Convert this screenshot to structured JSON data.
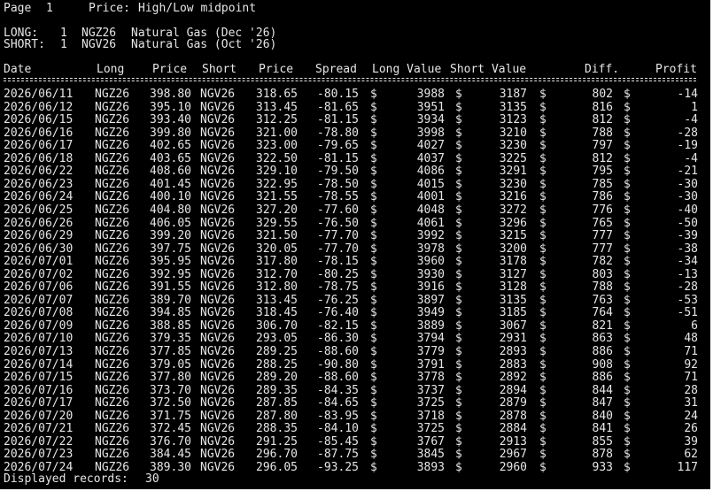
{
  "header": {
    "page_label": "Page",
    "page_number": "1",
    "price_label": "Price:",
    "price_mode": "High/Low midpoint"
  },
  "positions": {
    "long": {
      "label": "LONG:",
      "qty": "1",
      "symbol": "NGZ26",
      "description": "Natural Gas (Dec '26)"
    },
    "short": {
      "label": "SHORT:",
      "qty": "1",
      "symbol": "NGV26",
      "description": "Natural Gas (Oct '26)"
    }
  },
  "table": {
    "columns": [
      "Date",
      "Long",
      "Price",
      "Short",
      "Price",
      "Spread",
      "Long Value",
      "Short Value",
      "Diff.",
      "Profit"
    ],
    "currency_symbol": "$",
    "rows": [
      {
        "date": "2026/06/11",
        "long": "NGZ26",
        "long_price": "398.80",
        "short": "NGV26",
        "short_price": "318.65",
        "spread": "-80.15",
        "long_value": "3988",
        "short_value": "3187",
        "diff": "802",
        "profit": "-14"
      },
      {
        "date": "2026/06/12",
        "long": "NGZ26",
        "long_price": "395.10",
        "short": "NGV26",
        "short_price": "313.45",
        "spread": "-81.65",
        "long_value": "3951",
        "short_value": "3135",
        "diff": "816",
        "profit": "1"
      },
      {
        "date": "2026/06/15",
        "long": "NGZ26",
        "long_price": "393.40",
        "short": "NGV26",
        "short_price": "312.25",
        "spread": "-81.15",
        "long_value": "3934",
        "short_value": "3123",
        "diff": "812",
        "profit": "-4"
      },
      {
        "date": "2026/06/16",
        "long": "NGZ26",
        "long_price": "399.80",
        "short": "NGV26",
        "short_price": "321.00",
        "spread": "-78.80",
        "long_value": "3998",
        "short_value": "3210",
        "diff": "788",
        "profit": "-28"
      },
      {
        "date": "2026/06/17",
        "long": "NGZ26",
        "long_price": "402.65",
        "short": "NGV26",
        "short_price": "323.00",
        "spread": "-79.65",
        "long_value": "4027",
        "short_value": "3230",
        "diff": "797",
        "profit": "-19"
      },
      {
        "date": "2026/06/18",
        "long": "NGZ26",
        "long_price": "403.65",
        "short": "NGV26",
        "short_price": "322.50",
        "spread": "-81.15",
        "long_value": "4037",
        "short_value": "3225",
        "diff": "812",
        "profit": "-4"
      },
      {
        "date": "2026/06/22",
        "long": "NGZ26",
        "long_price": "408.60",
        "short": "NGV26",
        "short_price": "329.10",
        "spread": "-79.50",
        "long_value": "4086",
        "short_value": "3291",
        "diff": "795",
        "profit": "-21"
      },
      {
        "date": "2026/06/23",
        "long": "NGZ26",
        "long_price": "401.45",
        "short": "NGV26",
        "short_price": "322.95",
        "spread": "-78.50",
        "long_value": "4015",
        "short_value": "3230",
        "diff": "785",
        "profit": "-30"
      },
      {
        "date": "2026/06/24",
        "long": "NGZ26",
        "long_price": "400.10",
        "short": "NGV26",
        "short_price": "321.55",
        "spread": "-78.55",
        "long_value": "4001",
        "short_value": "3216",
        "diff": "786",
        "profit": "-30"
      },
      {
        "date": "2026/06/25",
        "long": "NGZ26",
        "long_price": "404.80",
        "short": "NGV26",
        "short_price": "327.20",
        "spread": "-77.60",
        "long_value": "4048",
        "short_value": "3272",
        "diff": "776",
        "profit": "-40"
      },
      {
        "date": "2026/06/26",
        "long": "NGZ26",
        "long_price": "406.05",
        "short": "NGV26",
        "short_price": "329.55",
        "spread": "-76.50",
        "long_value": "4061",
        "short_value": "3296",
        "diff": "765",
        "profit": "-50"
      },
      {
        "date": "2026/06/29",
        "long": "NGZ26",
        "long_price": "399.20",
        "short": "NGV26",
        "short_price": "321.50",
        "spread": "-77.70",
        "long_value": "3992",
        "short_value": "3215",
        "diff": "777",
        "profit": "-39"
      },
      {
        "date": "2026/06/30",
        "long": "NGZ26",
        "long_price": "397.75",
        "short": "NGV26",
        "short_price": "320.05",
        "spread": "-77.70",
        "long_value": "3978",
        "short_value": "3200",
        "diff": "777",
        "profit": "-38"
      },
      {
        "date": "2026/07/01",
        "long": "NGZ26",
        "long_price": "395.95",
        "short": "NGV26",
        "short_price": "317.80",
        "spread": "-78.15",
        "long_value": "3960",
        "short_value": "3178",
        "diff": "782",
        "profit": "-34"
      },
      {
        "date": "2026/07/02",
        "long": "NGZ26",
        "long_price": "392.95",
        "short": "NGV26",
        "short_price": "312.70",
        "spread": "-80.25",
        "long_value": "3930",
        "short_value": "3127",
        "diff": "803",
        "profit": "-13"
      },
      {
        "date": "2026/07/06",
        "long": "NGZ26",
        "long_price": "391.55",
        "short": "NGV26",
        "short_price": "312.80",
        "spread": "-78.75",
        "long_value": "3916",
        "short_value": "3128",
        "diff": "788",
        "profit": "-28"
      },
      {
        "date": "2026/07/07",
        "long": "NGZ26",
        "long_price": "389.70",
        "short": "NGV26",
        "short_price": "313.45",
        "spread": "-76.25",
        "long_value": "3897",
        "short_value": "3135",
        "diff": "763",
        "profit": "-53"
      },
      {
        "date": "2026/07/08",
        "long": "NGZ26",
        "long_price": "394.85",
        "short": "NGV26",
        "short_price": "318.45",
        "spread": "-76.40",
        "long_value": "3949",
        "short_value": "3185",
        "diff": "764",
        "profit": "-51"
      },
      {
        "date": "2026/07/09",
        "long": "NGZ26",
        "long_price": "388.85",
        "short": "NGV26",
        "short_price": "306.70",
        "spread": "-82.15",
        "long_value": "3889",
        "short_value": "3067",
        "diff": "821",
        "profit": "6"
      },
      {
        "date": "2026/07/10",
        "long": "NGZ26",
        "long_price": "379.35",
        "short": "NGV26",
        "short_price": "293.05",
        "spread": "-86.30",
        "long_value": "3794",
        "short_value": "2931",
        "diff": "863",
        "profit": "48"
      },
      {
        "date": "2026/07/13",
        "long": "NGZ26",
        "long_price": "377.85",
        "short": "NGV26",
        "short_price": "289.25",
        "spread": "-88.60",
        "long_value": "3779",
        "short_value": "2893",
        "diff": "886",
        "profit": "71"
      },
      {
        "date": "2026/07/14",
        "long": "NGZ26",
        "long_price": "379.05",
        "short": "NGV26",
        "short_price": "288.25",
        "spread": "-90.80",
        "long_value": "3791",
        "short_value": "2883",
        "diff": "908",
        "profit": "92"
      },
      {
        "date": "2026/07/15",
        "long": "NGZ26",
        "long_price": "377.80",
        "short": "NGV26",
        "short_price": "289.20",
        "spread": "-88.60",
        "long_value": "3778",
        "short_value": "2892",
        "diff": "886",
        "profit": "71"
      },
      {
        "date": "2026/07/16",
        "long": "NGZ26",
        "long_price": "373.70",
        "short": "NGV26",
        "short_price": "289.35",
        "spread": "-84.35",
        "long_value": "3737",
        "short_value": "2894",
        "diff": "844",
        "profit": "28"
      },
      {
        "date": "2026/07/17",
        "long": "NGZ26",
        "long_price": "372.50",
        "short": "NGV26",
        "short_price": "287.85",
        "spread": "-84.65",
        "long_value": "3725",
        "short_value": "2879",
        "diff": "847",
        "profit": "31"
      },
      {
        "date": "2026/07/20",
        "long": "NGZ26",
        "long_price": "371.75",
        "short": "NGV26",
        "short_price": "287.80",
        "spread": "-83.95",
        "long_value": "3718",
        "short_value": "2878",
        "diff": "840",
        "profit": "24"
      },
      {
        "date": "2026/07/21",
        "long": "NGZ26",
        "long_price": "372.45",
        "short": "NGV26",
        "short_price": "288.35",
        "spread": "-84.10",
        "long_value": "3725",
        "short_value": "2884",
        "diff": "841",
        "profit": "26"
      },
      {
        "date": "2026/07/22",
        "long": "NGZ26",
        "long_price": "376.70",
        "short": "NGV26",
        "short_price": "291.25",
        "spread": "-85.45",
        "long_value": "3767",
        "short_value": "2913",
        "diff": "855",
        "profit": "39"
      },
      {
        "date": "2026/07/23",
        "long": "NGZ26",
        "long_price": "384.45",
        "short": "NGV26",
        "short_price": "296.70",
        "spread": "-87.75",
        "long_value": "3845",
        "short_value": "2967",
        "diff": "878",
        "profit": "62"
      },
      {
        "date": "2026/07/24",
        "long": "NGZ26",
        "long_price": "389.30",
        "short": "NGV26",
        "short_price": "296.05",
        "spread": "-93.25",
        "long_value": "3893",
        "short_value": "2960",
        "diff": "933",
        "profit": "117"
      }
    ]
  },
  "footer": {
    "label": "Displayed records:",
    "count": "30"
  },
  "colors": {
    "background": "#000000",
    "text": "#e6e6e6"
  }
}
